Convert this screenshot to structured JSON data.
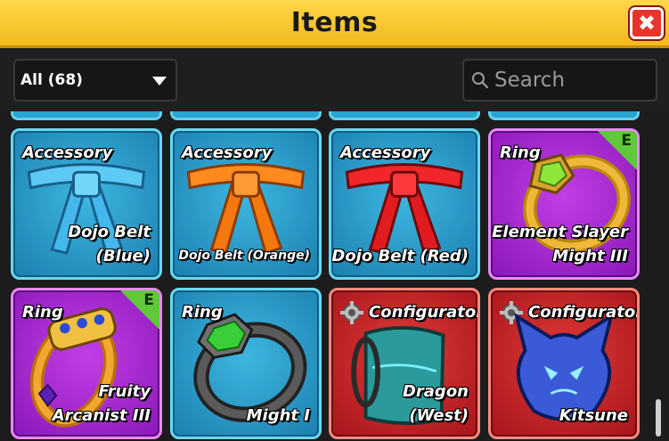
{
  "header": {
    "title": "Items",
    "close_glyph": "✖"
  },
  "toolbar": {
    "filter_label": "All (68)",
    "search_placeholder": "Search"
  },
  "colors": {
    "header": "#f5c22a",
    "blue_card": "#2aa4d0",
    "purple_card": "#a52bd0",
    "red_card": "#c8232a",
    "badge": "#5fc93a"
  },
  "items": [
    {
      "category": "Accessory",
      "name": "Dojo Belt (Blue)",
      "art": "blue-belt-icon"
    },
    {
      "category": "Accessory",
      "name": "Dojo Belt (Orange)",
      "art": "orange-belt-icon"
    },
    {
      "category": "Accessory",
      "name": "Dojo Belt (Red)",
      "art": "red-belt-icon"
    },
    {
      "category": "Ring",
      "name_line1": "Element Slayer",
      "name_line2": "Might III",
      "badge": "E",
      "art": "gold-ring-icon"
    },
    {
      "category": "Ring",
      "name_line1": "Fruity",
      "name_line2": "Arcanist III",
      "badge": "E",
      "art": "gold-ring-icon"
    },
    {
      "category": "Ring",
      "name": "Might I",
      "art": "iron-ring-icon"
    },
    {
      "category": "Configurator",
      "name_line1": "Dragon",
      "name_line2": "(West)",
      "art": "dragon-sleeve-icon"
    },
    {
      "category": "Configurator",
      "name": "Kitsune",
      "art": "kitsune-icon"
    }
  ]
}
